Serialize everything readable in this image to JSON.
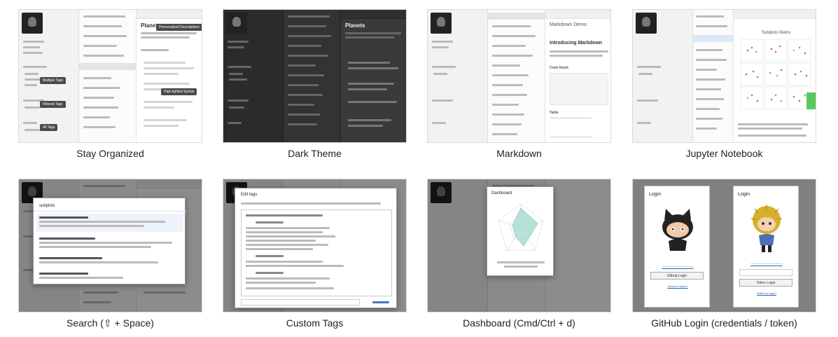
{
  "gallery": {
    "cards": [
      {
        "caption": "Stay Organized"
      },
      {
        "caption": "Dark Theme"
      },
      {
        "caption": "Markdown"
      },
      {
        "caption": "Jupyter Notebook"
      },
      {
        "caption": "Search (⇧ + Space)"
      },
      {
        "caption": "Custom Tags"
      },
      {
        "caption": "Dashboard (Cmd/Ctrl + d)"
      },
      {
        "caption": "GitHub Login (credentials / token)"
      }
    ]
  },
  "screens": {
    "organized": {
      "note_title": "Planets",
      "tag_labels": [
        "Personalized Descriptions",
        "Multiple Tags",
        "Filtered Tags",
        "All Tags",
        "High-lighted Syntax"
      ]
    },
    "dark": {
      "note_title": "Planets"
    },
    "markdown": {
      "note_title": "Markdown Demo",
      "heading": "Introducing Markdown",
      "section_1": "Code block",
      "section_2": "Table"
    },
    "jupyter": {
      "note_title": "Subplots Matrix"
    },
    "search": {
      "query": "subplots"
    },
    "custom_tags": {
      "title": "Edit tags"
    },
    "dashboard": {
      "title": "Dashboard"
    },
    "github": {
      "left": {
        "title": "Login",
        "button": "Github Login",
        "link": "Switch to token?"
      },
      "right": {
        "title": "Login",
        "button": "Token Login",
        "link": "Switch to login?"
      }
    }
  }
}
